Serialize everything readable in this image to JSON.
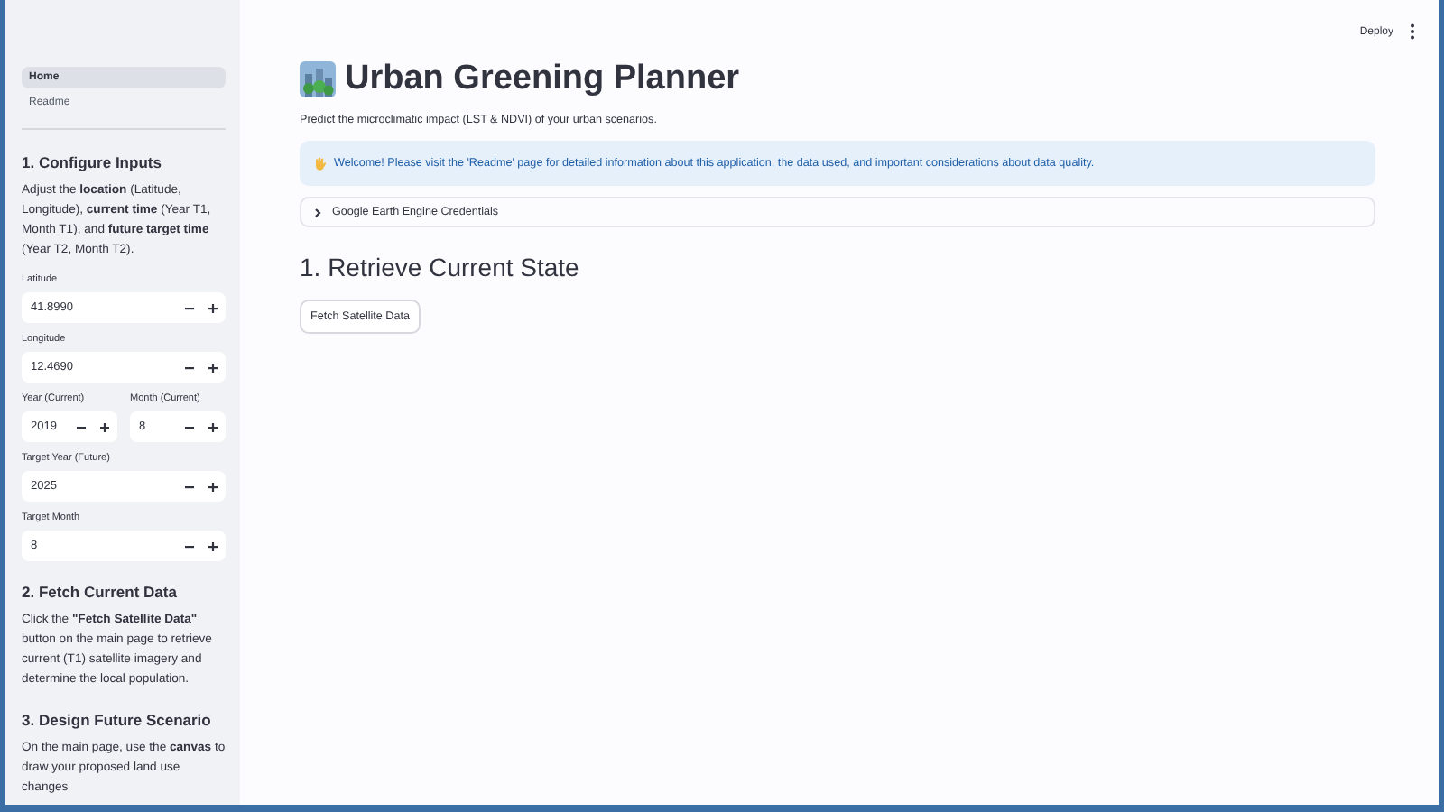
{
  "sidebar": {
    "nav": [
      {
        "label": "Home",
        "selected": true
      },
      {
        "label": "Readme",
        "selected": false
      }
    ],
    "sections": [
      {
        "heading": "1. Configure Inputs",
        "text": "Adjust the **location** (Latitude, Longitude), **current time** (Year T1, Month T1), and **future target time** (Year T2, Month T2).",
        "input_rows": [
          [
            {
              "label": "Latitude",
              "value": "41.8990"
            }
          ],
          [
            {
              "label": "Longitude",
              "value": "12.4690"
            }
          ],
          [
            {
              "label": "Year (Current)",
              "value": "2019"
            },
            {
              "label": "Month (Current)",
              "value": "8"
            }
          ],
          [
            {
              "label": "Target Year (Future)",
              "value": "2025"
            }
          ],
          [
            {
              "label": "Target Month",
              "value": "8"
            }
          ]
        ]
      },
      {
        "heading": "2. Fetch Current Data",
        "text": "Click the **\"Fetch Satellite Data\"** button on the main page to retrieve current (T1) satellite imagery and determine the local population."
      },
      {
        "heading": "3. Design Future Scenario",
        "text": "On the main page, use the **canvas** to draw your proposed land use changes"
      }
    ]
  },
  "header": {
    "deploy": "Deploy"
  },
  "main": {
    "title": "Urban Greening Planner",
    "subtitle": "Predict the microclimatic impact (LST & NDVI) of your urban scenarios.",
    "alert": "Welcome! Please visit the 'Readme' page for detailed information about this application, the data used, and important considerations about data quality.",
    "expander": {
      "label": "Google Earth Engine Credentials",
      "expanded": false
    },
    "section_heading": "1. Retrieve Current State",
    "button": "Fetch Satellite Data"
  }
}
